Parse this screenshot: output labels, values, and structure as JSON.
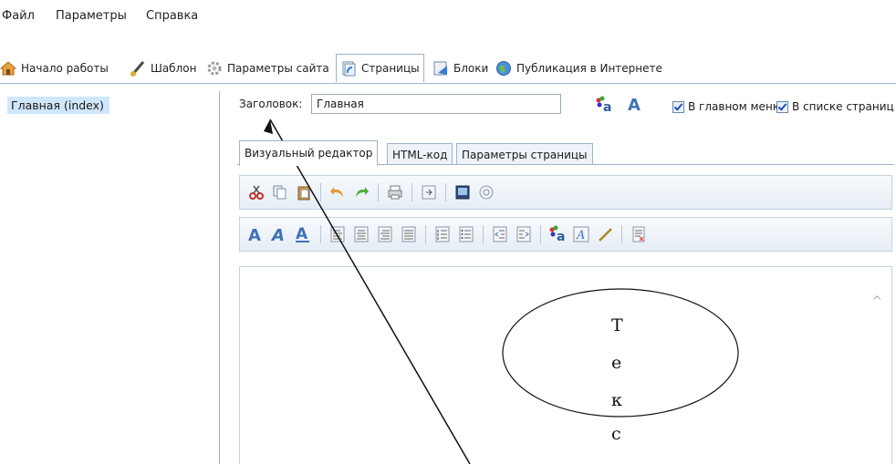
{
  "menu": {
    "file": "Файл",
    "params": "Параметры",
    "help": "Справка"
  },
  "main_tabs": [
    {
      "label": "Начало работы"
    },
    {
      "label": "Шаблон"
    },
    {
      "label": "Параметры сайта"
    },
    {
      "label": "Страницы"
    },
    {
      "label": "Блоки"
    },
    {
      "label": "Публикация в Интернете"
    }
  ],
  "pages_list": [
    {
      "label": "Главная (index)"
    }
  ],
  "title_field": {
    "label": "Заголовок:",
    "value": "Главная"
  },
  "checkboxes": {
    "in_main_menu": "В главном меню",
    "in_pages_list": "В списке страниц"
  },
  "editor_tabs": [
    {
      "label": "Визуальный редактор"
    },
    {
      "label": "HTML-код"
    },
    {
      "label": "Параметры страницы"
    }
  ],
  "annotation": {
    "letters": [
      "Т",
      "е",
      "к",
      "с"
    ]
  },
  "colors": {
    "accent": "#9fb3cc",
    "selection": "#cfe6fb"
  }
}
